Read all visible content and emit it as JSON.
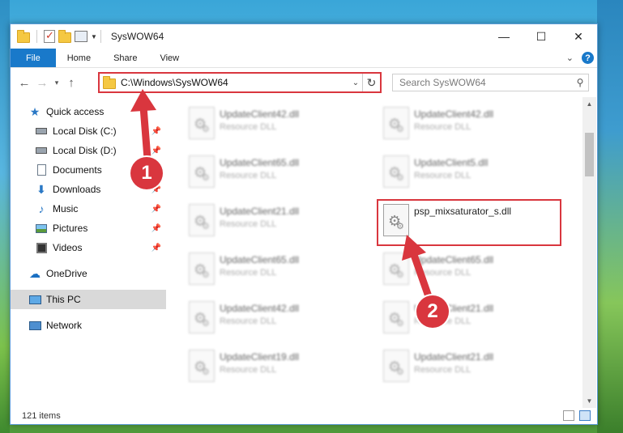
{
  "window": {
    "title": "SysWOW64"
  },
  "ribbon": {
    "tabs": [
      {
        "label": "File"
      },
      {
        "label": "Home"
      },
      {
        "label": "Share"
      },
      {
        "label": "View"
      }
    ]
  },
  "address_bar": {
    "path": "C:\\Windows\\SysWOW64"
  },
  "search": {
    "placeholder": "Search SysWOW64"
  },
  "sidebar": {
    "quick_access": "Quick access",
    "items": [
      {
        "label": "Local Disk (C:)"
      },
      {
        "label": "Local Disk (D:)"
      },
      {
        "label": "Documents"
      },
      {
        "label": "Downloads"
      },
      {
        "label": "Music"
      },
      {
        "label": "Pictures"
      },
      {
        "label": "Videos"
      }
    ],
    "onedrive": "OneDrive",
    "this_pc": "This PC",
    "network": "Network"
  },
  "files": [
    {
      "name": "UpdateClient42.dll",
      "type": "Resource DLL"
    },
    {
      "name": "UpdateClient42.dll",
      "type": "Resource DLL"
    },
    {
      "name": "UpdateClient65.dll",
      "type": "Resource DLL"
    },
    {
      "name": "UpdateClient5.dll",
      "type": "Resource DLL"
    },
    {
      "name": "UpdateClient21.dll",
      "type": "Resource DLL"
    },
    {
      "name": "psp_mixsaturator_s.dll",
      "type": ""
    },
    {
      "name": "UpdateClient65.dll",
      "type": "Resource DLL"
    },
    {
      "name": "UpdateClient65.dll",
      "type": "Resource DLL"
    },
    {
      "name": "UpdateClient42.dll",
      "type": "Resource DLL"
    },
    {
      "name": "UpdateClient21.dll",
      "type": "Resource DLL"
    },
    {
      "name": "UpdateClient19.dll",
      "type": "Resource DLL"
    },
    {
      "name": "UpdateClient21.dll",
      "type": "Resource DLL"
    }
  ],
  "status": {
    "item_count": "121 items"
  },
  "annotations": {
    "step1": "1",
    "step2": "2",
    "color": "#d9363e"
  }
}
